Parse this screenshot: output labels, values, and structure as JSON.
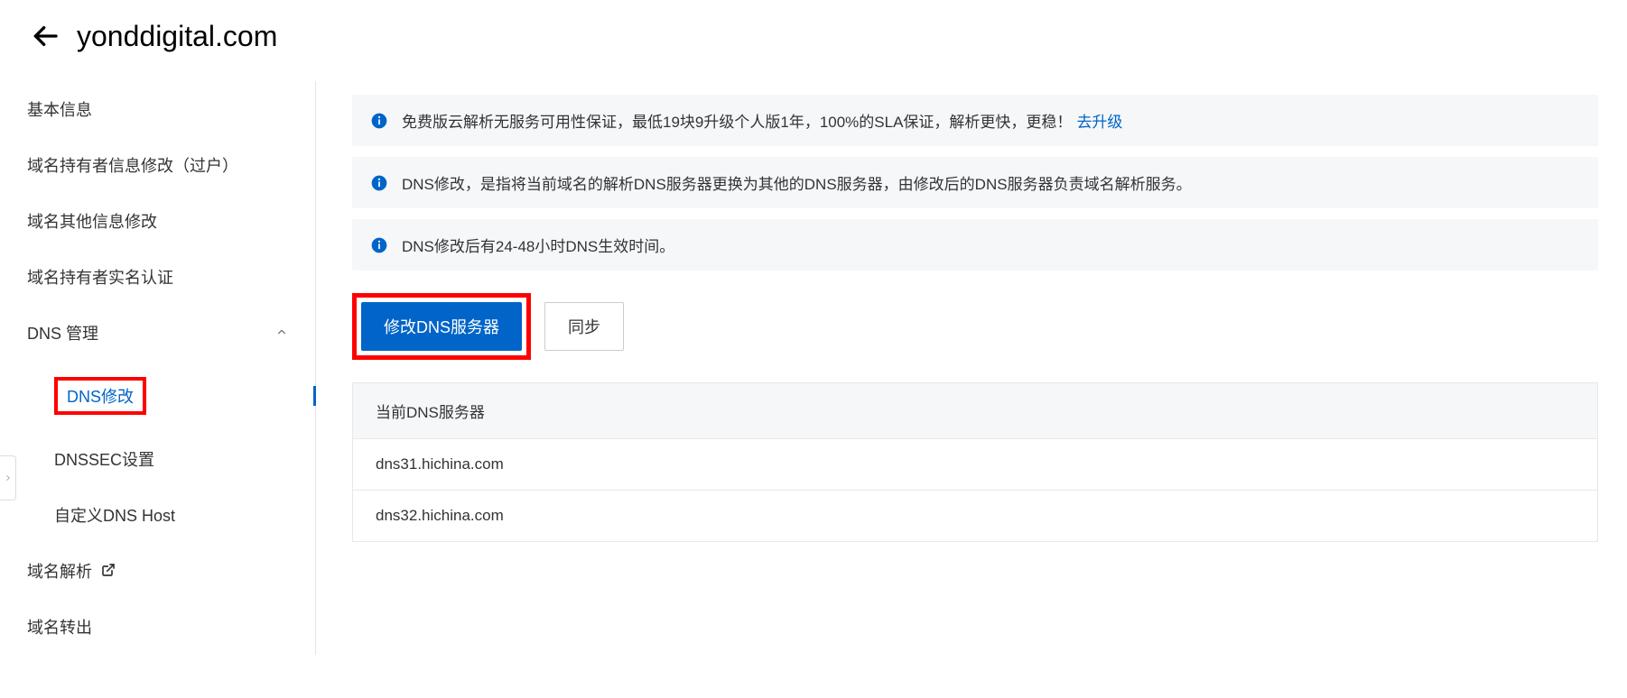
{
  "header": {
    "title": "yonddigital.com"
  },
  "sidebar": {
    "items": [
      {
        "label": "基本信息"
      },
      {
        "label": "域名持有者信息修改（过户）"
      },
      {
        "label": "域名其他信息修改"
      },
      {
        "label": "域名持有者实名认证"
      },
      {
        "label": "DNS 管理"
      },
      {
        "label": "域名解析"
      },
      {
        "label": "域名转出"
      }
    ],
    "subitems": [
      {
        "label": "DNS修改"
      },
      {
        "label": "DNSSEC设置"
      },
      {
        "label": "自定义DNS Host"
      }
    ]
  },
  "banners": [
    {
      "text": "免费版云解析无服务可用性保证，最低19块9升级个人版1年，100%的SLA保证，解析更快，更稳！",
      "link": "去升级"
    },
    {
      "text": "DNS修改，是指将当前域名的解析DNS服务器更换为其他的DNS服务器，由修改后的DNS服务器负责域名解析服务。"
    },
    {
      "text": "DNS修改后有24-48小时DNS生效时间。"
    }
  ],
  "buttons": {
    "modify_dns": "修改DNS服务器",
    "sync": "同步"
  },
  "table": {
    "header": "当前DNS服务器",
    "rows": [
      "dns31.hichina.com",
      "dns32.hichina.com"
    ]
  }
}
